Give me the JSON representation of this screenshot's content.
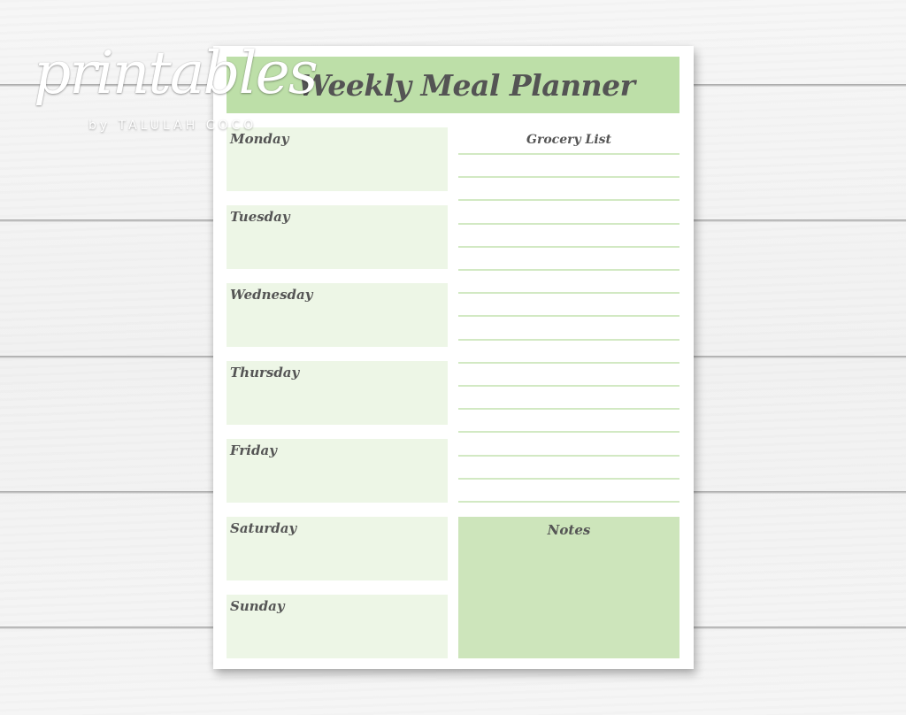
{
  "watermark": {
    "brand": "printables",
    "byline": "by TALULAH COCO"
  },
  "planner": {
    "title": "Weekly Meal Planner",
    "days": [
      {
        "label": "Monday"
      },
      {
        "label": "Tuesday"
      },
      {
        "label": "Wednesday"
      },
      {
        "label": "Thursday"
      },
      {
        "label": "Friday"
      },
      {
        "label": "Saturday"
      },
      {
        "label": "Sunday"
      }
    ],
    "grocery": {
      "title": "Grocery List",
      "line_count": 16
    },
    "notes": {
      "title": "Notes"
    }
  },
  "colors": {
    "header_green": "#bddfa8",
    "day_box_green": "#edf6e6",
    "notes_green": "#cde5bb",
    "rule_line_green": "#d2e9c3",
    "text_gray": "#555555"
  }
}
